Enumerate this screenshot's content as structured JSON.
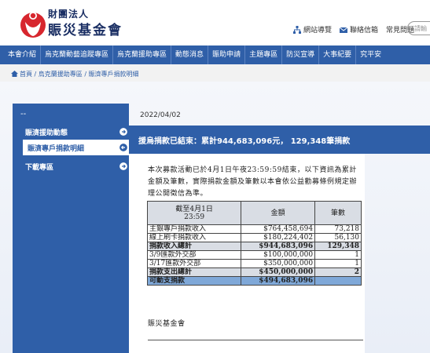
{
  "header": {
    "org_small": "財團法人",
    "org_big": "賑災基金會",
    "links": [
      {
        "label": "網站導覽",
        "icon": "sitemap-icon"
      },
      {
        "label": "聯絡信箱",
        "icon": "mail-icon"
      },
      {
        "label": "常見問題",
        "icon": ""
      }
    ],
    "search_placeholder": "請輸"
  },
  "nav": [
    "本會介紹",
    "烏克蘭動藝追蹤專區",
    "烏克蘭援助專區",
    "動態消息",
    "賑助申請",
    "主題專區",
    "防災宣導",
    "大事紀要",
    "究平安"
  ],
  "breadcrumb": {
    "home": "首頁",
    "sep": " / ",
    "level1": "烏克蘭援助專區",
    "level2": "賑濟專戶捐款明細"
  },
  "sidebar": {
    "dash": "--",
    "items": [
      {
        "label": "賑濟援助動態"
      },
      {
        "label": "賑濟專戶捐款明細"
      },
      {
        "label": "下載專區"
      }
    ]
  },
  "main": {
    "date": "2022/04/02",
    "banner": "援烏捐款已結束：累計944,683,096元， 129,348筆捐款",
    "intro": "本次募款活動已於4月1日午夜23:59:59結束，以下資訊為累計金額及筆數，實際捐款金額及筆數以本會依公益勸募條例規定辦理公開徵信為準。",
    "table": {
      "headers": [
        "截至4月1日\n23:59",
        "金額",
        "筆數"
      ],
      "rows": [
        {
          "label": "主銀專戶捐款收入",
          "amount": "$764,458,694",
          "count": "73,218",
          "style": ""
        },
        {
          "label": "線上刷卡捐款收入",
          "amount": "$180,224,402",
          "count": "56,130",
          "style": ""
        },
        {
          "label": "捐款收入總計",
          "amount": "$944,683,096",
          "count": "129,348",
          "style": "total"
        },
        {
          "label": "3/9匯款外交部",
          "amount": "$100,000,000",
          "count": "1",
          "style": ""
        },
        {
          "label": "3/17匯款外交部",
          "amount": "$350,000,000",
          "count": "1",
          "style": ""
        },
        {
          "label": "捐款支出總計",
          "amount": "$450,000,000",
          "count": "2",
          "style": "total"
        },
        {
          "label": "可動支捐款",
          "amount": "$494,683,096",
          "count": "",
          "style": "final"
        }
      ]
    },
    "signature": "賑災基金會"
  }
}
